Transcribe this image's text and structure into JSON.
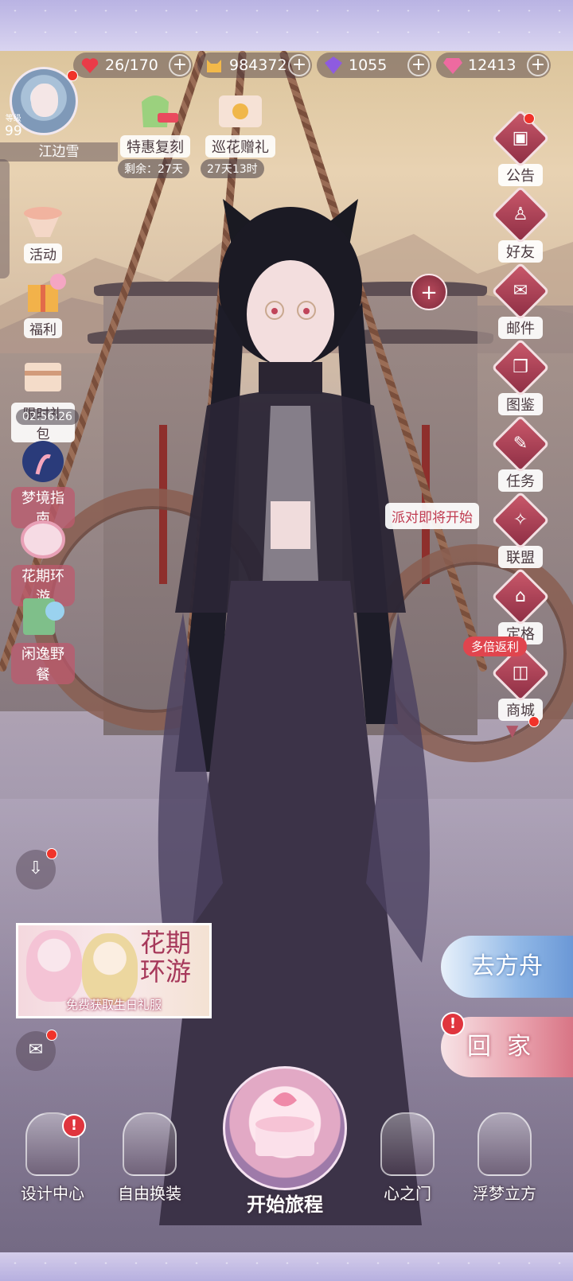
{
  "resources": {
    "stamina": "26/170",
    "gold": "984372",
    "crystal": "1055",
    "diamond": "12413"
  },
  "player": {
    "level_label": "等级",
    "level": "99",
    "name": "江边雪"
  },
  "events": [
    {
      "label": "特惠复刻",
      "timer": "剩余：27天"
    },
    {
      "label": "巡花赠礼",
      "timer": "27天13时"
    }
  ],
  "left_menu": {
    "activity": "活动",
    "welfare": "福利",
    "limited_pack": "限时礼包",
    "limited_pack_timer": "02:56:26",
    "dream_guide": "梦境指南",
    "flower_tour": "花期环游",
    "picnic": "闲逸野餐"
  },
  "right_menu": {
    "notice": "公告",
    "friends": "好友",
    "mail": "邮件",
    "album": "图鉴",
    "tasks": "任务",
    "alliance": "联盟",
    "snapshot": "定格",
    "multi_rebate": "多倍返利",
    "shop": "商城"
  },
  "party_tip": "派对即将开始",
  "banner": {
    "title": "花期环游",
    "subtitle": "免费获取生日礼服"
  },
  "buttons": {
    "go_ark": "去方舟",
    "go_home": "回家",
    "alert_mark": "!"
  },
  "bottom_nav": {
    "design_center": "设计中心",
    "free_dress": "自由换装",
    "start_journey": "开始旅程",
    "heart_gate": "心之门",
    "dream_cube": "浮梦立方"
  },
  "colors": {
    "accent_red": "#e0353e",
    "menu_diamond": "#b4495e",
    "ark_blue": "#8fb7e6",
    "home_pink": "#e9a1ad"
  }
}
